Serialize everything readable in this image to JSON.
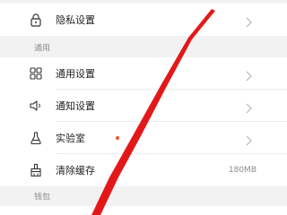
{
  "privacy": {
    "label": "隐私设置",
    "icon": "lock-icon"
  },
  "sections": {
    "general_header": "通用",
    "wallet_header": "钱包"
  },
  "general": {
    "general_settings": {
      "label": "通用设置",
      "icon": "grid-icon"
    },
    "notification_settings": {
      "label": "通知设置",
      "icon": "speaker-icon"
    },
    "lab": {
      "label": "实验室",
      "icon": "flask-icon",
      "has_new_dot": true
    },
    "clear_cache": {
      "label": "清除缓存",
      "icon": "broom-icon",
      "value": "180MB"
    }
  },
  "colors": {
    "background": "#f2f2f2",
    "row": "#ffffff",
    "text": "#222222",
    "muted": "#8c8c8c",
    "dot": "#f2542d",
    "overlay_stroke": "#e00000"
  }
}
